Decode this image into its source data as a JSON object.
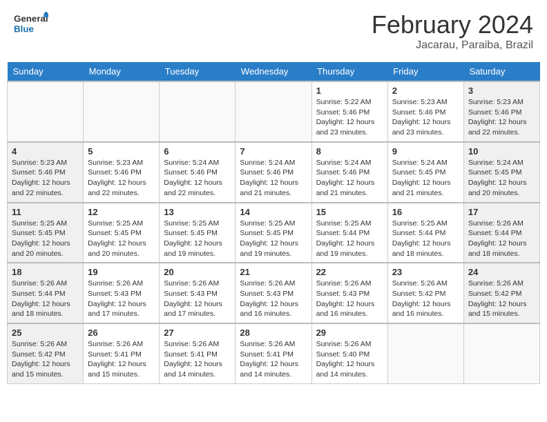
{
  "header": {
    "logo_general": "General",
    "logo_blue": "Blue",
    "month_year": "February 2024",
    "location": "Jacarau, Paraiba, Brazil"
  },
  "weekdays": [
    "Sunday",
    "Monday",
    "Tuesday",
    "Wednesday",
    "Thursday",
    "Friday",
    "Saturday"
  ],
  "weeks": [
    [
      {
        "day": "",
        "info": ""
      },
      {
        "day": "",
        "info": ""
      },
      {
        "day": "",
        "info": ""
      },
      {
        "day": "",
        "info": ""
      },
      {
        "day": "1",
        "info": "Sunrise: 5:22 AM\nSunset: 5:46 PM\nDaylight: 12 hours\nand 23 minutes."
      },
      {
        "day": "2",
        "info": "Sunrise: 5:23 AM\nSunset: 5:46 PM\nDaylight: 12 hours\nand 23 minutes."
      },
      {
        "day": "3",
        "info": "Sunrise: 5:23 AM\nSunset: 5:46 PM\nDaylight: 12 hours\nand 22 minutes."
      }
    ],
    [
      {
        "day": "4",
        "info": "Sunrise: 5:23 AM\nSunset: 5:46 PM\nDaylight: 12 hours\nand 22 minutes."
      },
      {
        "day": "5",
        "info": "Sunrise: 5:23 AM\nSunset: 5:46 PM\nDaylight: 12 hours\nand 22 minutes."
      },
      {
        "day": "6",
        "info": "Sunrise: 5:24 AM\nSunset: 5:46 PM\nDaylight: 12 hours\nand 22 minutes."
      },
      {
        "day": "7",
        "info": "Sunrise: 5:24 AM\nSunset: 5:46 PM\nDaylight: 12 hours\nand 21 minutes."
      },
      {
        "day": "8",
        "info": "Sunrise: 5:24 AM\nSunset: 5:46 PM\nDaylight: 12 hours\nand 21 minutes."
      },
      {
        "day": "9",
        "info": "Sunrise: 5:24 AM\nSunset: 5:45 PM\nDaylight: 12 hours\nand 21 minutes."
      },
      {
        "day": "10",
        "info": "Sunrise: 5:24 AM\nSunset: 5:45 PM\nDaylight: 12 hours\nand 20 minutes."
      }
    ],
    [
      {
        "day": "11",
        "info": "Sunrise: 5:25 AM\nSunset: 5:45 PM\nDaylight: 12 hours\nand 20 minutes."
      },
      {
        "day": "12",
        "info": "Sunrise: 5:25 AM\nSunset: 5:45 PM\nDaylight: 12 hours\nand 20 minutes."
      },
      {
        "day": "13",
        "info": "Sunrise: 5:25 AM\nSunset: 5:45 PM\nDaylight: 12 hours\nand 19 minutes."
      },
      {
        "day": "14",
        "info": "Sunrise: 5:25 AM\nSunset: 5:45 PM\nDaylight: 12 hours\nand 19 minutes."
      },
      {
        "day": "15",
        "info": "Sunrise: 5:25 AM\nSunset: 5:44 PM\nDaylight: 12 hours\nand 19 minutes."
      },
      {
        "day": "16",
        "info": "Sunrise: 5:25 AM\nSunset: 5:44 PM\nDaylight: 12 hours\nand 18 minutes."
      },
      {
        "day": "17",
        "info": "Sunrise: 5:26 AM\nSunset: 5:44 PM\nDaylight: 12 hours\nand 18 minutes."
      }
    ],
    [
      {
        "day": "18",
        "info": "Sunrise: 5:26 AM\nSunset: 5:44 PM\nDaylight: 12 hours\nand 18 minutes."
      },
      {
        "day": "19",
        "info": "Sunrise: 5:26 AM\nSunset: 5:43 PM\nDaylight: 12 hours\nand 17 minutes."
      },
      {
        "day": "20",
        "info": "Sunrise: 5:26 AM\nSunset: 5:43 PM\nDaylight: 12 hours\nand 17 minutes."
      },
      {
        "day": "21",
        "info": "Sunrise: 5:26 AM\nSunset: 5:43 PM\nDaylight: 12 hours\nand 16 minutes."
      },
      {
        "day": "22",
        "info": "Sunrise: 5:26 AM\nSunset: 5:43 PM\nDaylight: 12 hours\nand 16 minutes."
      },
      {
        "day": "23",
        "info": "Sunrise: 5:26 AM\nSunset: 5:42 PM\nDaylight: 12 hours\nand 16 minutes."
      },
      {
        "day": "24",
        "info": "Sunrise: 5:26 AM\nSunset: 5:42 PM\nDaylight: 12 hours\nand 15 minutes."
      }
    ],
    [
      {
        "day": "25",
        "info": "Sunrise: 5:26 AM\nSunset: 5:42 PM\nDaylight: 12 hours\nand 15 minutes."
      },
      {
        "day": "26",
        "info": "Sunrise: 5:26 AM\nSunset: 5:41 PM\nDaylight: 12 hours\nand 15 minutes."
      },
      {
        "day": "27",
        "info": "Sunrise: 5:26 AM\nSunset: 5:41 PM\nDaylight: 12 hours\nand 14 minutes."
      },
      {
        "day": "28",
        "info": "Sunrise: 5:26 AM\nSunset: 5:41 PM\nDaylight: 12 hours\nand 14 minutes."
      },
      {
        "day": "29",
        "info": "Sunrise: 5:26 AM\nSunset: 5:40 PM\nDaylight: 12 hours\nand 14 minutes."
      },
      {
        "day": "",
        "info": ""
      },
      {
        "day": "",
        "info": ""
      }
    ]
  ]
}
